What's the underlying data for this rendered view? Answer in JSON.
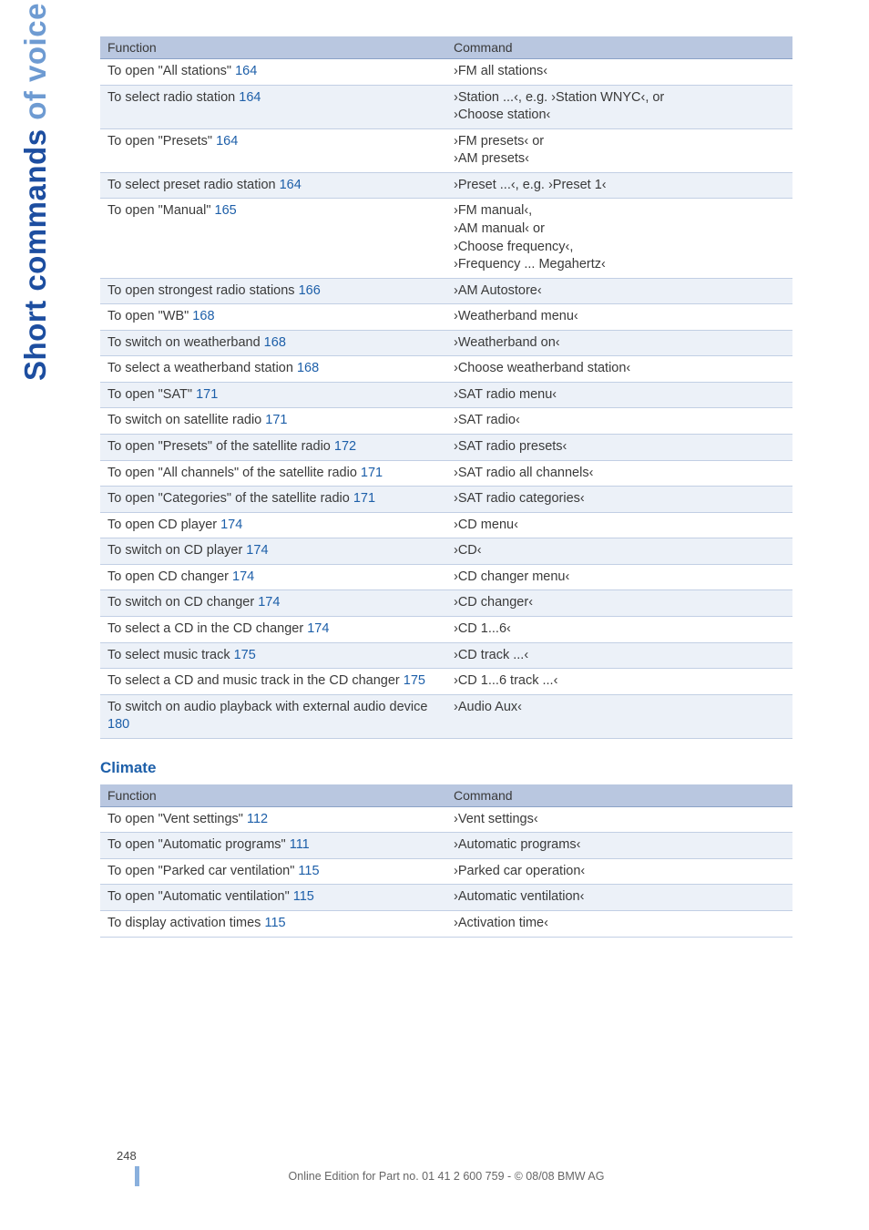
{
  "side": {
    "part1": "Short commands",
    "part2": "of voice command system"
  },
  "headers": {
    "function": "Function",
    "command": "Command"
  },
  "sections": {
    "climate": "Climate"
  },
  "footer": {
    "page": "248",
    "text": "Online Edition for Part no. 01 41 2 600 759 - © 08/08 BMW AG"
  },
  "tables": {
    "entertainment": [
      {
        "fn": "To open \"All stations\"",
        "pg": "164",
        "cmd": "›FM all stations‹"
      },
      {
        "fn": "To select radio station",
        "pg": "164",
        "cmd": "›Station ...‹, e.g. ›Station WNYC‹, or\n›Choose station‹"
      },
      {
        "fn": "To open \"Presets\"",
        "pg": "164",
        "cmd": "›FM presets‹ or\n›AM presets‹"
      },
      {
        "fn": "To select preset radio station",
        "pg": "164",
        "cmd": "›Preset ...‹, e.g. ›Preset 1‹"
      },
      {
        "fn": "To open \"Manual\"",
        "pg": "165",
        "cmd": "›FM manual‹,\n›AM manual‹ or\n›Choose frequency‹,\n›Frequency ... Megahertz‹"
      },
      {
        "fn": "To open strongest radio stations",
        "pg": "166",
        "cmd": "›AM Autostore‹"
      },
      {
        "fn": "To open \"WB\"",
        "pg": "168",
        "cmd": "›Weatherband menu‹"
      },
      {
        "fn": "To switch on weatherband",
        "pg": "168",
        "cmd": "›Weatherband on‹"
      },
      {
        "fn": "To select a weatherband station",
        "pg": "168",
        "cmd": "›Choose weatherband station‹"
      },
      {
        "fn": "To open \"SAT\"",
        "pg": "171",
        "cmd": "›SAT radio menu‹"
      },
      {
        "fn": "To switch on satellite radio",
        "pg": "171",
        "cmd": "›SAT radio‹"
      },
      {
        "fn": "To open \"Presets\" of the satellite radio",
        "pg": "172",
        "cmd": "›SAT radio presets‹"
      },
      {
        "fn": "To open \"All channels\" of the satellite radio",
        "pg": "171",
        "cmd": "›SAT radio all channels‹"
      },
      {
        "fn": "To open \"Categories\" of the satellite radio",
        "pg": "171",
        "cmd": "›SAT radio categories‹"
      },
      {
        "fn": "To open CD player",
        "pg": "174",
        "cmd": "›CD menu‹"
      },
      {
        "fn": "To switch on CD player",
        "pg": "174",
        "cmd": "›CD‹"
      },
      {
        "fn": "To open CD changer",
        "pg": "174",
        "cmd": "›CD changer menu‹"
      },
      {
        "fn": "To switch on CD changer",
        "pg": "174",
        "cmd": "›CD changer‹"
      },
      {
        "fn": "To select a CD in the CD changer",
        "pg": "174",
        "cmd": "›CD 1...6‹"
      },
      {
        "fn": "To select music track",
        "pg": "175",
        "cmd": "›CD track ...‹"
      },
      {
        "fn": "To select a CD and music track in the CD changer",
        "pg": "175",
        "cmd": "›CD 1...6 track ...‹"
      },
      {
        "fn": "To switch on audio playback with external audio device",
        "pg": "180",
        "cmd": "›Audio Aux‹"
      }
    ],
    "climate": [
      {
        "fn": "To open \"Vent settings\"",
        "pg": "112",
        "cmd": "›Vent settings‹"
      },
      {
        "fn": "To open \"Automatic programs\"",
        "pg": "111",
        "cmd": "›Automatic programs‹"
      },
      {
        "fn": "To open \"Parked car ventilation\"",
        "pg": "115",
        "cmd": "›Parked car operation‹"
      },
      {
        "fn": "To open \"Automatic ventilation\"",
        "pg": "115",
        "cmd": "›Automatic ventilation‹"
      },
      {
        "fn": "To display activation times",
        "pg": "115",
        "cmd": "›Activation time‹"
      }
    ]
  }
}
